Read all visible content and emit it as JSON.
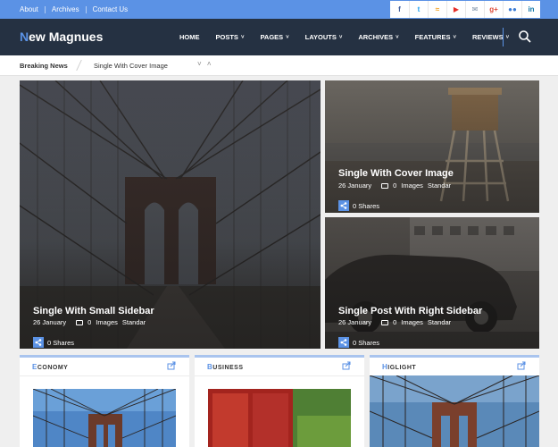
{
  "topbar": {
    "links": [
      "About",
      "Archives",
      "Contact Us"
    ],
    "social_icons": [
      "facebook-icon",
      "twitter-icon",
      "rss-icon",
      "youtube-icon",
      "email-icon",
      "google-plus-icon",
      "flickr-icon",
      "linkedin-icon"
    ],
    "social_glyphs": [
      "f",
      "t",
      "≈",
      "▶",
      "✉",
      "g+",
      "●●",
      "in"
    ],
    "social_colors": [
      "#3b5998",
      "#1da1f2",
      "#f39c12",
      "#e52d27",
      "#7a8fa6",
      "#dd4b39",
      "#3a7bd5",
      "#0e76a8"
    ]
  },
  "logo": {
    "first_letter": "N",
    "rest": "ew Magnues"
  },
  "nav": {
    "items": [
      {
        "label": "HOME",
        "has_dropdown": false
      },
      {
        "label": "POSTS",
        "has_dropdown": true
      },
      {
        "label": "PAGES",
        "has_dropdown": true
      },
      {
        "label": "LAYOUTS",
        "has_dropdown": true
      },
      {
        "label": "ARCHIVES",
        "has_dropdown": true
      },
      {
        "label": "FEATURES",
        "has_dropdown": true
      },
      {
        "label": "REVIEWS",
        "has_dropdown": true
      }
    ],
    "chevron": "˅"
  },
  "breaking": {
    "label": "Breaking News",
    "ticker": "Single With Cover Image",
    "arrows": "˅ ˄"
  },
  "featured": [
    {
      "title": "Single With Small Sidebar",
      "date": "26 January",
      "comments": "0",
      "tag1": "Images",
      "tag2": "Standar",
      "shares": "0 Shares"
    },
    {
      "title": "Single With Cover Image",
      "date": "26 January",
      "comments": "0",
      "tag1": "Images",
      "tag2": "Standar",
      "shares": "0 Shares"
    },
    {
      "title": "Single Post With Right Sidebar",
      "date": "26 January",
      "comments": "0",
      "tag1": "Images",
      "tag2": "Standar",
      "shares": "0 Shares"
    }
  ],
  "columns": [
    {
      "first": "E",
      "rest": "CONOMY"
    },
    {
      "first": "B",
      "rest": "USINESS"
    },
    {
      "first": "H",
      "rest": "IGLIGHT"
    }
  ],
  "colors": {
    "accent": "#5b92e5",
    "nav_bg": "#253142",
    "page_bg": "#efefef"
  }
}
